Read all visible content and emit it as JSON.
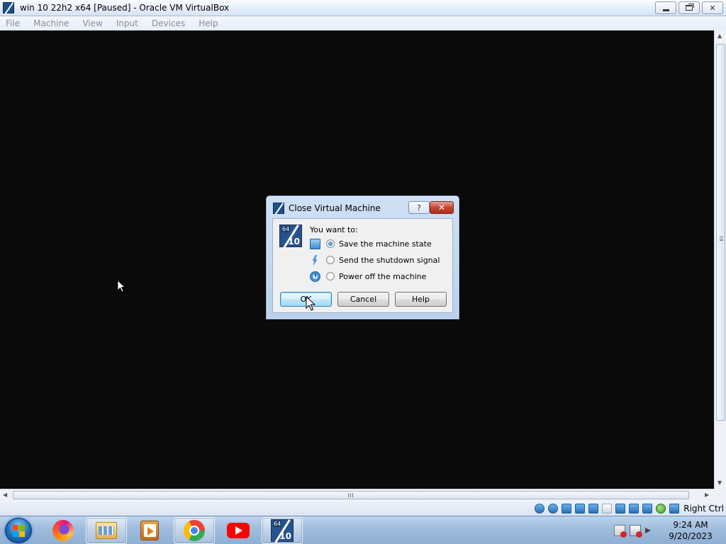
{
  "window": {
    "title": "win 10 22h2 x64 [Paused] - Oracle VM VirtualBox",
    "controls": {
      "minimize": "minimize",
      "maximize": "restore",
      "close": "✕"
    }
  },
  "menu": {
    "items": [
      "File",
      "Machine",
      "View",
      "Input",
      "Devices",
      "Help"
    ]
  },
  "dialog": {
    "title": "Close Virtual Machine",
    "help_glyph": "?",
    "close_glyph": "✕",
    "icon_badge_top": "64",
    "icon_badge_bottom": "10",
    "prompt": "You want to:",
    "options": [
      {
        "label": "Save the machine state",
        "selected": true,
        "icon": "save-state-icon"
      },
      {
        "label": "Send the shutdown signal",
        "selected": false,
        "icon": "lightning-bolt-icon"
      },
      {
        "label": "Power off the machine",
        "selected": false,
        "icon": "power-icon"
      }
    ],
    "buttons": {
      "ok": "OK",
      "cancel": "Cancel",
      "help": "Help"
    }
  },
  "statusbar": {
    "host_key": "Right Ctrl",
    "indicators": [
      "hard-disk-icon",
      "optical-drive-icon",
      "audio-icon",
      "network-icon",
      "usb-icon",
      "shared-folders-icon",
      "display-icon",
      "video-capture-icon",
      "virtualization-icon",
      "mouse-integration-icon",
      "keyboard-capture-icon"
    ]
  },
  "taskbar": {
    "apps": [
      "firefox-icon",
      "windows-explorer-icon",
      "media-player-icon",
      "chrome-icon",
      "youtube-icon",
      "virtualbox-icon"
    ],
    "vbox_badge_top": "64",
    "vbox_badge_bottom": "10",
    "clock": {
      "time": "9:24 AM",
      "date": "9/20/2023"
    }
  },
  "colors": {
    "vm_background": "#0b0a0a",
    "dialog_frame": "#b9d1ec",
    "taskbar": "#9fbcdc",
    "accent": "#3c7fb1"
  }
}
